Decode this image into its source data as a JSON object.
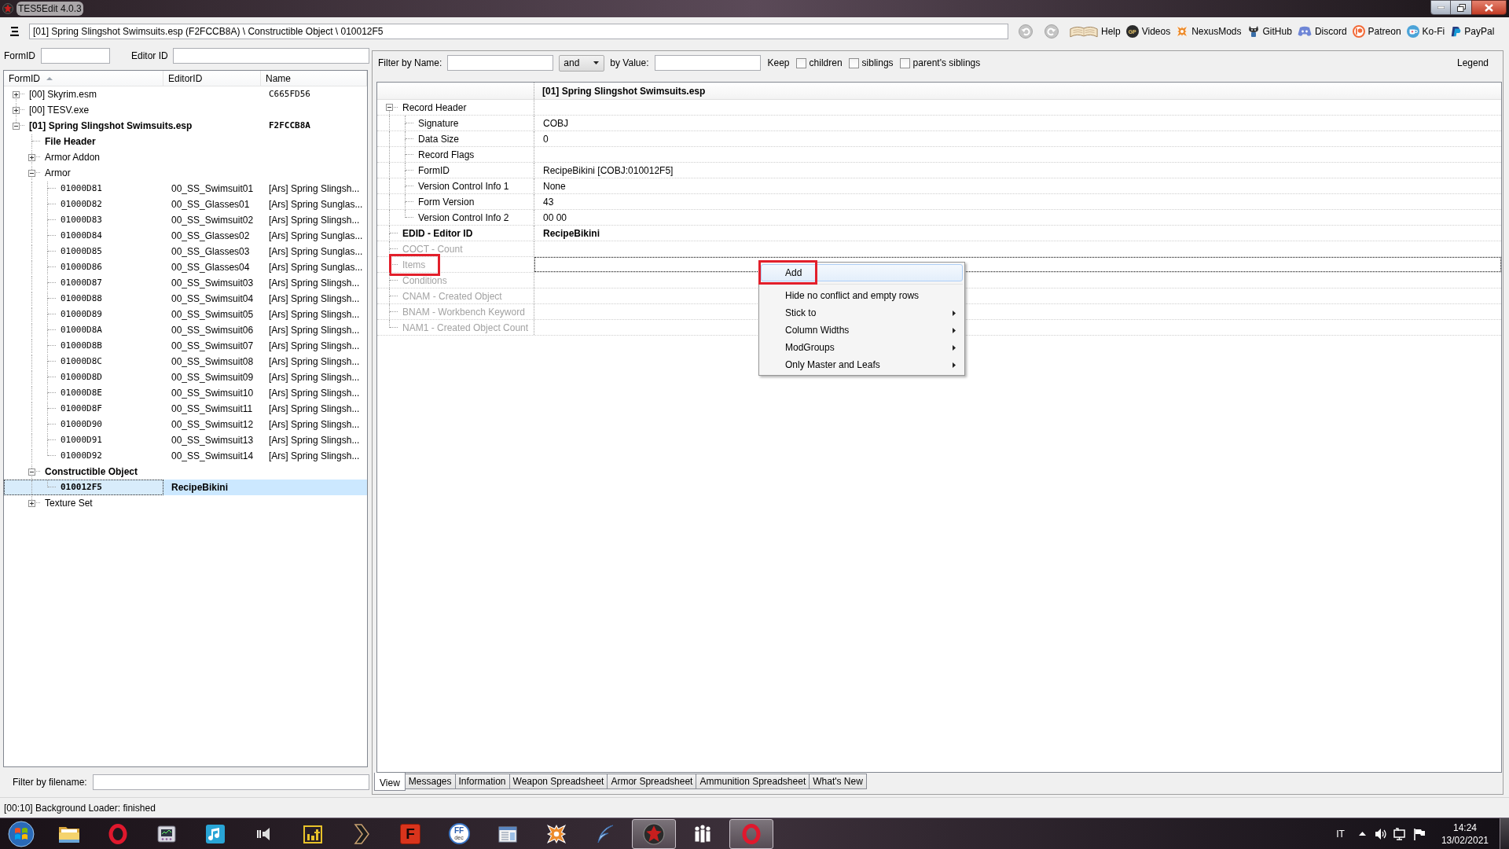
{
  "window": {
    "title": "TES5Edit 4.0.3"
  },
  "toolbar": {
    "path": "[01] Spring Slingshot Swimsuits.esp (F2FCCB8A) \\ Constructible Object \\ 010012F5",
    "links": [
      {
        "kind": "book",
        "label": "Help"
      },
      {
        "kind": "disc",
        "badge": "GP",
        "label": "Videos"
      },
      {
        "kind": "star",
        "label": "NexusMods"
      },
      {
        "kind": "cat",
        "label": "GitHub"
      },
      {
        "kind": "gamepad",
        "label": "Discord"
      },
      {
        "kind": "ring",
        "label": "Patreon"
      },
      {
        "kind": "cup",
        "label": "Ko-Fi"
      },
      {
        "kind": "pay",
        "label": "PayPal"
      }
    ]
  },
  "navigator": {
    "form_id_label": "FormID",
    "editor_id_label": "Editor ID",
    "columns": [
      {
        "label": "FormID",
        "sorted": true
      },
      {
        "label": "EditorID",
        "sorted": false
      },
      {
        "label": "Name",
        "sorted": false
      }
    ],
    "tree": [
      {
        "kind": "file",
        "label": "[00] Skyrim.esm",
        "name": "C665FD56",
        "expanded": false,
        "bold": false,
        "selected": false
      },
      {
        "kind": "file",
        "label": "[00] TESV.exe",
        "expanded": false,
        "bold": false,
        "selected": false
      },
      {
        "kind": "file",
        "label": "[01] Spring Slingshot Swimsuits.esp",
        "name": "F2FCCB8A",
        "expanded": true,
        "bold": true,
        "selected": false,
        "children": [
          {
            "kind": "group",
            "label": "File Header",
            "bold": true,
            "selected": false
          },
          {
            "kind": "group",
            "label": "Armor Addon",
            "expanded": false,
            "bold": false,
            "selected": false
          },
          {
            "kind": "group",
            "label": "Armor",
            "expanded": true,
            "bold": false,
            "selected": false,
            "children": [
              {
                "kind": "record",
                "label": "01000D81",
                "editor_id": "00_SS_Swimsuit01",
                "name": "[Ars] Spring Slingsh...",
                "bold": false,
                "selected": false
              },
              {
                "kind": "record",
                "label": "01000D82",
                "editor_id": "00_SS_Glasses01",
                "name": "[Ars] Spring Sunglas...",
                "bold": false,
                "selected": false
              },
              {
                "kind": "record",
                "label": "01000D83",
                "editor_id": "00_SS_Swimsuit02",
                "name": "[Ars] Spring Slingsh...",
                "bold": false,
                "selected": false
              },
              {
                "kind": "record",
                "label": "01000D84",
                "editor_id": "00_SS_Glasses02",
                "name": "[Ars] Spring Sunglas...",
                "bold": false,
                "selected": false
              },
              {
                "kind": "record",
                "label": "01000D85",
                "editor_id": "00_SS_Glasses03",
                "name": "[Ars] Spring Sunglas...",
                "bold": false,
                "selected": false
              },
              {
                "kind": "record",
                "label": "01000D86",
                "editor_id": "00_SS_Glasses04",
                "name": "[Ars] Spring Sunglas...",
                "bold": false,
                "selected": false
              },
              {
                "kind": "record",
                "label": "01000D87",
                "editor_id": "00_SS_Swimsuit03",
                "name": "[Ars] Spring Slingsh...",
                "bold": false,
                "selected": false
              },
              {
                "kind": "record",
                "label": "01000D88",
                "editor_id": "00_SS_Swimsuit04",
                "name": "[Ars] Spring Slingsh...",
                "bold": false,
                "selected": false
              },
              {
                "kind": "record",
                "label": "01000D89",
                "editor_id": "00_SS_Swimsuit05",
                "name": "[Ars] Spring Slingsh...",
                "bold": false,
                "selected": false
              },
              {
                "kind": "record",
                "label": "01000D8A",
                "editor_id": "00_SS_Swimsuit06",
                "name": "[Ars] Spring Slingsh...",
                "bold": false,
                "selected": false
              },
              {
                "kind": "record",
                "label": "01000D8B",
                "editor_id": "00_SS_Swimsuit07",
                "name": "[Ars] Spring Slingsh...",
                "bold": false,
                "selected": false
              },
              {
                "kind": "record",
                "label": "01000D8C",
                "editor_id": "00_SS_Swimsuit08",
                "name": "[Ars] Spring Slingsh...",
                "bold": false,
                "selected": false
              },
              {
                "kind": "record",
                "label": "01000D8D",
                "editor_id": "00_SS_Swimsuit09",
                "name": "[Ars] Spring Slingsh...",
                "bold": false,
                "selected": false
              },
              {
                "kind": "record",
                "label": "01000D8E",
                "editor_id": "00_SS_Swimsuit10",
                "name": "[Ars] Spring Slingsh...",
                "bold": false,
                "selected": false
              },
              {
                "kind": "record",
                "label": "01000D8F",
                "editor_id": "00_SS_Swimsuit11",
                "name": "[Ars] Spring Slingsh...",
                "bold": false,
                "selected": false
              },
              {
                "kind": "record",
                "label": "01000D90",
                "editor_id": "00_SS_Swimsuit12",
                "name": "[Ars] Spring Slingsh...",
                "bold": false,
                "selected": false
              },
              {
                "kind": "record",
                "label": "01000D91",
                "editor_id": "00_SS_Swimsuit13",
                "name": "[Ars] Spring Slingsh...",
                "bold": false,
                "selected": false
              },
              {
                "kind": "record",
                "label": "01000D92",
                "editor_id": "00_SS_Swimsuit14",
                "name": "[Ars] Spring Slingsh...",
                "bold": false,
                "selected": false
              }
            ]
          },
          {
            "kind": "group",
            "label": "Constructible Object",
            "expanded": true,
            "bold": true,
            "selected": false,
            "children": [
              {
                "kind": "record",
                "label": "010012F5",
                "editor_id": "RecipeBikini",
                "bold": true,
                "selected": true
              }
            ]
          },
          {
            "kind": "group",
            "label": "Texture Set",
            "expanded": false,
            "bold": false,
            "selected": false
          }
        ]
      }
    ],
    "file_filter_label": "Filter by filename:"
  },
  "record_view": {
    "filter": {
      "name_label": "Filter by Name:",
      "operator": "and",
      "value_label": "by Value:",
      "keep_label": "Keep",
      "keep_options": [
        {
          "label": "children",
          "checked": false
        },
        {
          "label": "siblings",
          "checked": false
        },
        {
          "label": "parent's siblings",
          "checked": false
        }
      ],
      "legend": "Legend"
    },
    "header": "[01] Spring Slingshot Swimsuits.esp",
    "rows": [
      {
        "label": "Record Header",
        "expanded": true,
        "bold": false,
        "greyed": false,
        "selected": false,
        "marked": false,
        "children": [
          {
            "label": "Signature",
            "value": "COBJ",
            "selected": false
          },
          {
            "label": "Data Size",
            "value": "0",
            "selected": false
          },
          {
            "label": "Record Flags",
            "selected": false
          },
          {
            "label": "FormID",
            "value": "RecipeBikini [COBJ:010012F5]",
            "selected": false
          },
          {
            "label": "Version Control Info 1",
            "value": "None",
            "selected": false
          },
          {
            "label": "Form Version",
            "value": "43",
            "selected": false
          },
          {
            "label": "Version Control Info 2",
            "value": "00 00",
            "selected": false
          }
        ]
      },
      {
        "label": "EDID - Editor ID",
        "value": "RecipeBikini",
        "bold": true,
        "greyed": false,
        "selected": false,
        "marked": false
      },
      {
        "label": "COCT - Count",
        "bold": false,
        "greyed": true,
        "selected": false,
        "marked": false
      },
      {
        "label": "Items",
        "bold": false,
        "greyed": true,
        "selected": true,
        "marked": true
      },
      {
        "label": "Conditions",
        "bold": false,
        "greyed": true,
        "selected": false,
        "marked": false
      },
      {
        "label": "CNAM - Created Object",
        "bold": false,
        "greyed": true,
        "selected": false,
        "marked": false
      },
      {
        "label": "BNAM - Workbench Keyword",
        "bold": false,
        "greyed": true,
        "selected": false,
        "marked": false
      },
      {
        "label": "NAM1 - Created Object Count",
        "bold": false,
        "greyed": true,
        "selected": false,
        "marked": false
      }
    ],
    "context_menu": {
      "items": [
        {
          "kind": "item",
          "label": "Add",
          "highlighted": true,
          "marked": true,
          "submenu": false
        },
        {
          "kind": "separator"
        },
        {
          "kind": "item",
          "label": "Hide no conflict and empty rows",
          "highlighted": false,
          "marked": false,
          "submenu": false
        },
        {
          "kind": "item",
          "label": "Stick to",
          "highlighted": false,
          "marked": false,
          "submenu": true
        },
        {
          "kind": "item",
          "label": "Column Widths",
          "highlighted": false,
          "marked": false,
          "submenu": true
        },
        {
          "kind": "item",
          "label": "ModGroups",
          "highlighted": false,
          "marked": false,
          "submenu": true
        },
        {
          "kind": "item",
          "label": "Only Master and Leafs",
          "highlighted": false,
          "marked": false,
          "submenu": true
        }
      ]
    },
    "tabs": [
      {
        "label": "View",
        "selected": true
      },
      {
        "label": "Messages",
        "selected": false
      },
      {
        "label": "Information",
        "selected": false
      },
      {
        "label": "Weapon Spreadsheet",
        "selected": false
      },
      {
        "label": "Armor Spreadsheet",
        "selected": false
      },
      {
        "label": "Ammunition Spreadsheet",
        "selected": false
      },
      {
        "label": "What's New",
        "selected": false
      }
    ]
  },
  "status_bar": {
    "message": "[00:10] Background Loader: finished"
  },
  "taskbar": {
    "apps": [
      {
        "kind": "folder",
        "running": false
      },
      {
        "kind": "ring",
        "running": false
      },
      {
        "kind": "gadget",
        "running": false
      },
      {
        "kind": "note",
        "running": false
      },
      {
        "kind": "speaker",
        "running": false
      },
      {
        "kind": "blocks",
        "running": false
      },
      {
        "kind": "chevron",
        "running": false
      },
      {
        "kind": "letter",
        "glyph": "F",
        "running": false
      },
      {
        "kind": "disc",
        "glyph": "FF",
        "caption": "dec",
        "running": false
      },
      {
        "kind": "window",
        "running": false
      },
      {
        "kind": "star",
        "running": false
      },
      {
        "kind": "feather",
        "running": false
      },
      {
        "kind": "emblem",
        "running": true
      },
      {
        "kind": "figures",
        "running": false
      },
      {
        "kind": "ring",
        "running": true
      }
    ],
    "tray": {
      "language": "IT",
      "time": "14:24",
      "date": "13/02/2021"
    }
  }
}
